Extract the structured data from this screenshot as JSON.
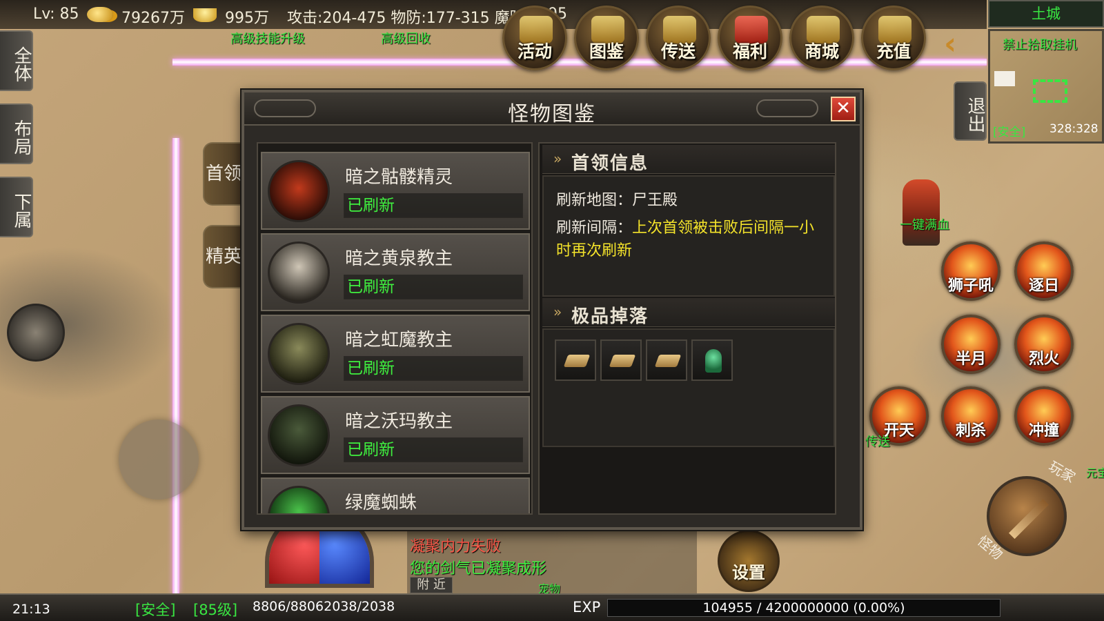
{
  "top_stats": {
    "level": "Lv: 85",
    "gold": "79267万",
    "ingot": "995万",
    "combat": "攻击:204-475 物防:177-315 魔防",
    "combat_tail": "295"
  },
  "floating_texts": {
    "skill_upgrade": "高级技能升级",
    "recycle": "高级回收",
    "full_hp": "一键满血",
    "teleport_partial": "传送",
    "yuanbao_partial": "元宝",
    "pet_partial": "宠物"
  },
  "top_buttons": [
    "活动",
    "图鉴",
    "传送",
    "福利",
    "商城",
    "充值"
  ],
  "left_tabs": [
    "全体",
    "布局",
    "下属"
  ],
  "minimap": {
    "zone": "土城",
    "notice": "禁止拾取挂机",
    "safe": "[安全]",
    "coords": "328:328"
  },
  "exit_button": "退出",
  "skills": [
    "狮子吼",
    "逐日",
    "半月",
    "烈火",
    "开天",
    "刺杀",
    "冲撞"
  ],
  "joystick_labels": {
    "player": "玩家",
    "monster": "怪物"
  },
  "settings_button": "设置",
  "dialog": {
    "title": "怪物图鉴",
    "close": "✕",
    "side_tabs": [
      "首领",
      "精英"
    ],
    "monsters": [
      {
        "name": "暗之骷髅精灵",
        "status": "已刷新"
      },
      {
        "name": "暗之黄泉教主",
        "status": "已刷新"
      },
      {
        "name": "暗之虹魔教主",
        "status": "已刷新"
      },
      {
        "name": "暗之沃玛教主",
        "status": "已刷新"
      },
      {
        "name": "绿魔蜘蛛",
        "status": ""
      }
    ],
    "boss_info": {
      "header": "首领信息",
      "map_label": "刷新地图：",
      "map_value": "尸王殿",
      "interval_label": "刷新间隔：",
      "interval_value": "上次首领被击败后间隔一小时再次刷新"
    },
    "drops": {
      "header": "极品掉落",
      "items": [
        "scroll-item",
        "scroll-item",
        "scroll-item",
        "helmet-item"
      ]
    }
  },
  "chat": {
    "line1": "凝聚内力失败",
    "line2": "您的剑气已凝聚成形",
    "tab": "附 近"
  },
  "bottom": {
    "time": "21:13",
    "safe": "[安全]",
    "level": "[85级]",
    "hp_mp": "8806/88062038/2038",
    "exp_label": "EXP",
    "exp_value": "104955 / 4200000000 (0.00%)"
  },
  "colors": {
    "status_green": "#3ff03f",
    "highlight_yellow": "#f5e42a",
    "chat_red": "#ff5a4a",
    "zone_pink": "#f3a6f0"
  }
}
